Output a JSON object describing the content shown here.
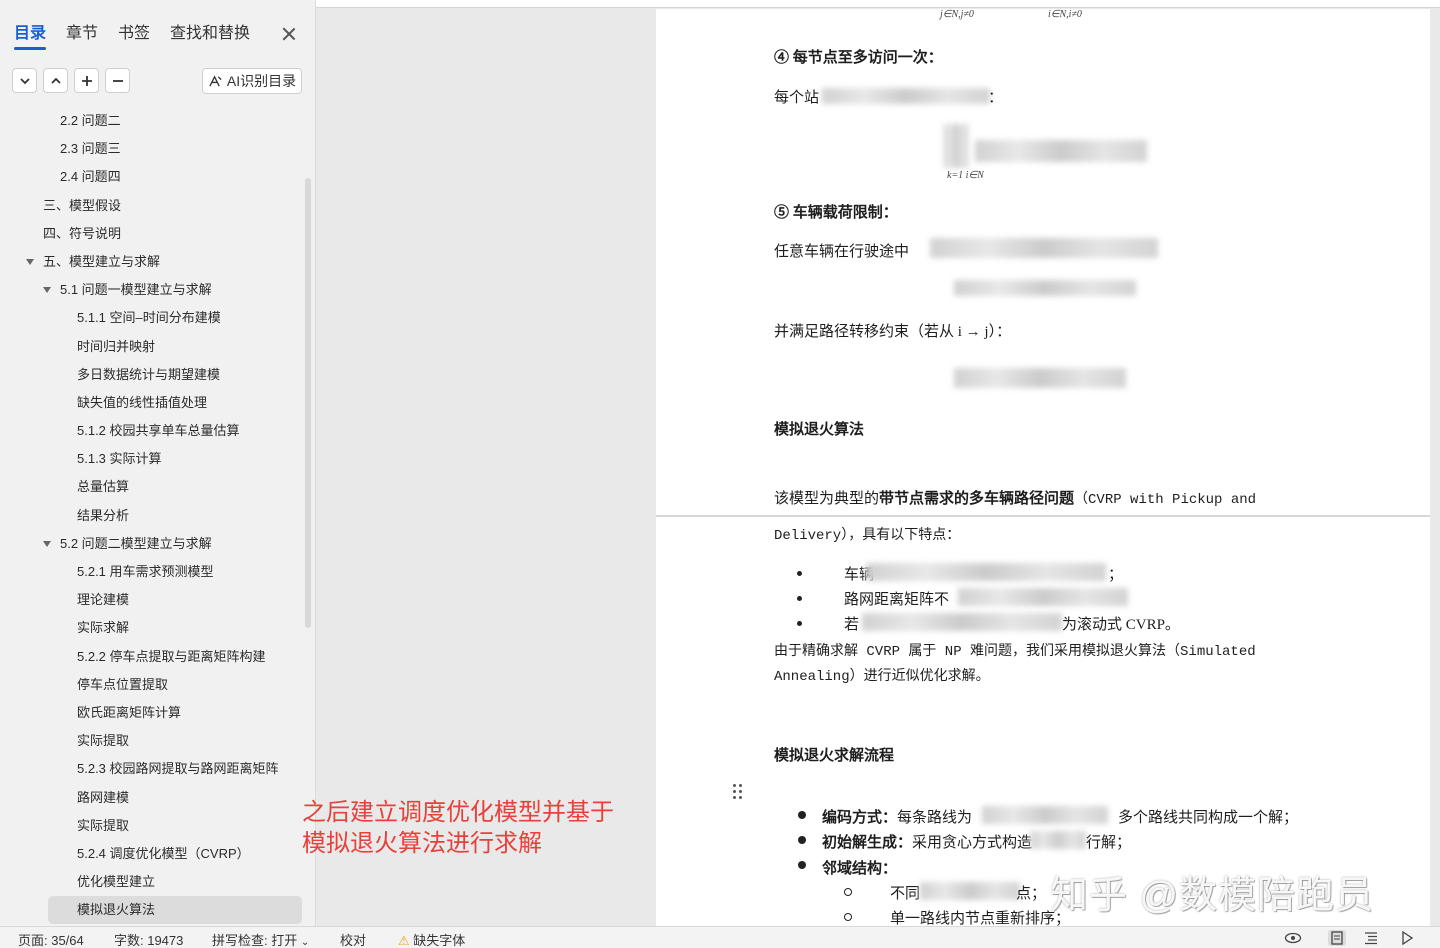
{
  "sidebar": {
    "tabs": [
      {
        "label": "目录",
        "active": true
      },
      {
        "label": "章节"
      },
      {
        "label": "书签"
      },
      {
        "label": "查找和替换"
      }
    ],
    "ai_button_label": "AI识别目录",
    "toc": [
      {
        "label": "2.2 问题二",
        "level": 3
      },
      {
        "label": "2.3 问题三",
        "level": 3
      },
      {
        "label": "2.4 问题四",
        "level": 3
      },
      {
        "label": "三、模型假设",
        "level": 1
      },
      {
        "label": "四、符号说明",
        "level": 1
      },
      {
        "label": "五、模型建立与求解",
        "level": 1,
        "expanded": true
      },
      {
        "label": "5.1 问题一模型建立与求解",
        "level": 2,
        "expanded": true
      },
      {
        "label": "5.1.1  空间–时间分布建模",
        "level": 3
      },
      {
        "label": "时间归并映射",
        "level": 3
      },
      {
        "label": "多日数据统计与期望建模",
        "level": 3
      },
      {
        "label": "缺失值的线性插值处理",
        "level": 3
      },
      {
        "label": "5.1.2  校园共享单车总量估算",
        "level": 3
      },
      {
        "label": "5.1.3  实际计算",
        "level": 3
      },
      {
        "label": "总量估算",
        "level": 3
      },
      {
        "label": "结果分析",
        "level": 3
      },
      {
        "label": "5.2 问题二模型建立与求解",
        "level": 2,
        "expanded": true
      },
      {
        "label": "5.2.1  用车需求预测模型",
        "level": 3
      },
      {
        "label": "理论建模",
        "level": 3
      },
      {
        "label": "实际求解",
        "level": 3
      },
      {
        "label": "5.2.2  停车点提取与距离矩阵构建",
        "level": 3
      },
      {
        "label": "停车点位置提取",
        "level": 3
      },
      {
        "label": "欧氏距离矩阵计算",
        "level": 3
      },
      {
        "label": "实际提取",
        "level": 3
      },
      {
        "label": "5.2.3  校园路网提取与路网距离矩阵",
        "level": 3
      },
      {
        "label": "路网建模",
        "level": 3
      },
      {
        "label": "实际提取",
        "level": 3
      },
      {
        "label": "5.2.4  调度优化模型（CVRP）",
        "level": 3
      },
      {
        "label": "优化模型建立",
        "level": 3
      },
      {
        "label": "模拟退火算法",
        "level": 3,
        "selected": true
      }
    ]
  },
  "document": {
    "math_sub_left": "j∈N,j≠0",
    "math_sub_right": "i∈N,i≠0",
    "c4_title": "④ 每节点至多访问一次：",
    "c4_text_a": "每个站",
    "c4_text_b": "：",
    "c4_math_sub": "k=1  i∈N",
    "c5_title": "⑤ 车辆载荷限制：",
    "c5_text": "任意车辆在行驶途中",
    "path_text": "并满足路径转移约束（若从 i → j）：",
    "sa_heading": "模拟退火算法",
    "intro_a": "该模型为典型的",
    "intro_b": "带节点需求的多车辆路径问题",
    "intro_c": "（CVRP with Pickup and",
    "intro_d": "Delivery），具有以下特点：",
    "feature_1": "车辆",
    "feature_1_tail": "；",
    "feature_2": "路网距离矩阵不",
    "feature_3": "若",
    "feature_3_tail": "为滚动式 CVRP。",
    "np_line_1": "由于精确求解 CVRP 属于 NP 难问题，我们采用模拟退火算法（Simulated",
    "np_line_2": "Annealing）进行近似优化求解。",
    "flow_heading": "模拟退火求解流程",
    "enc_label": "编码方式：",
    "enc_text_a": "每条路线为",
    "enc_text_b": "多个路线共同构成一个解；",
    "init_label": "初始解生成：",
    "init_text_a": "采用贪心方式构造",
    "init_text_b": "行解；",
    "nb_label": "邻域结构：",
    "nb_1": "不同",
    "nb_1_tail": "点；",
    "nb_2": "单一路线内节点重新排序；"
  },
  "annotation": {
    "line1": "之后建立调度优化模型并基于",
    "line2": "模拟退火算法进行求解"
  },
  "watermark": "知乎 @数模陪跑员",
  "status": {
    "page": "页面: 35/64",
    "words": "字数: 19473",
    "spell": "拼写检查: 打开",
    "proof": "校对",
    "missing_font": "缺失字体"
  },
  "colors": {
    "accent": "#1a5fd0",
    "annotation": "#e8403a",
    "warning": "#f0a020"
  }
}
